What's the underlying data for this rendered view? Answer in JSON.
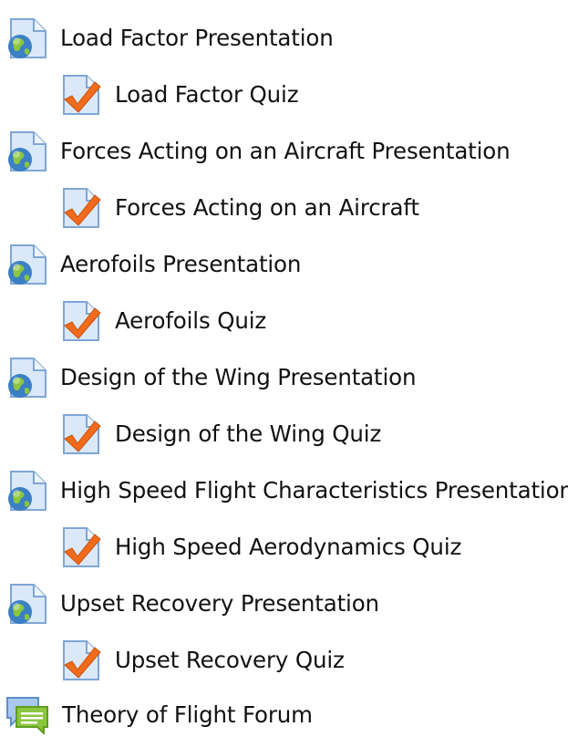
{
  "activities": [
    {
      "type": "url",
      "icon": "web-page-globe-icon",
      "label": "Load Factor Presentation"
    },
    {
      "type": "quiz",
      "icon": "quiz-checkmark-icon",
      "label": "Load Factor Quiz"
    },
    {
      "type": "url",
      "icon": "web-page-globe-icon",
      "label": "Forces Acting on an Aircraft Presentation"
    },
    {
      "type": "quiz",
      "icon": "quiz-checkmark-icon",
      "label": "Forces Acting on an Aircraft"
    },
    {
      "type": "url",
      "icon": "web-page-globe-icon",
      "label": "Aerofoils Presentation"
    },
    {
      "type": "quiz",
      "icon": "quiz-checkmark-icon",
      "label": "Aerofoils Quiz"
    },
    {
      "type": "url",
      "icon": "web-page-globe-icon",
      "label": "Design of the Wing Presentation"
    },
    {
      "type": "quiz",
      "icon": "quiz-checkmark-icon",
      "label": "Design of the Wing Quiz"
    },
    {
      "type": "url",
      "icon": "web-page-globe-icon",
      "label": "High Speed Flight Characteristics Presentation"
    },
    {
      "type": "quiz",
      "icon": "quiz-checkmark-icon",
      "label": "High Speed Aerodynamics Quiz"
    },
    {
      "type": "url",
      "icon": "web-page-globe-icon",
      "label": "Upset Recovery Presentation"
    },
    {
      "type": "quiz",
      "icon": "quiz-checkmark-icon",
      "label": "Upset Recovery Quiz"
    },
    {
      "type": "forum",
      "icon": "forum-speech-bubbles-icon",
      "label": "Theory of Flight Forum"
    }
  ],
  "colors": {
    "text": "#111111",
    "page_icon_fill": "#dbe8f8",
    "page_icon_stroke": "#7ea6d6",
    "globe_blue": "#3b7fc4",
    "globe_green": "#8cc63f",
    "check_orange": "#f26a1b",
    "forum_green": "#8cc63f",
    "forum_blue": "#a9c8ec"
  }
}
